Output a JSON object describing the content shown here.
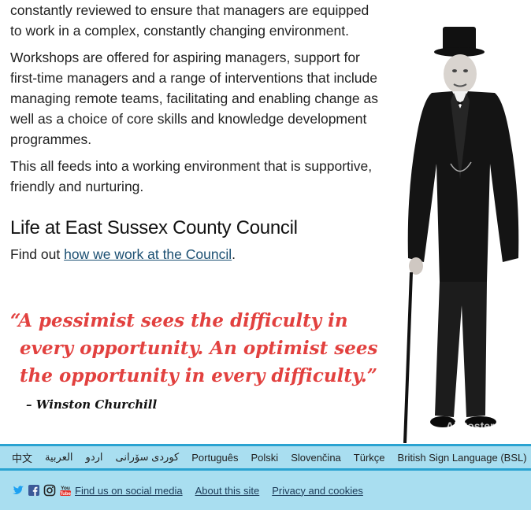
{
  "paragraphs": [
    "constantly reviewed to ensure that managers are equipped to work in a complex, constantly changing environment.",
    "Workshops are offered for aspiring managers, support for first-time managers and a range of interventions that include managing remote teams, facilitating and enabling change as well as a choice of core skills and knowledge development programmes.",
    "This all feeds into a working environment that is supportive, friendly and nurturing."
  ],
  "section": {
    "title": "Life at East Sussex County Council",
    "find_prefix": "Find out ",
    "find_link": "how we work at the Council",
    "find_suffix": "."
  },
  "quote": {
    "line1": "“A pessimist sees the difficulty in",
    "line2": "every opportunity. An optimist sees",
    "line3": "the opportunity in every difficulty.”",
    "author": "– Winston Churchill"
  },
  "photo": {
    "watermark": "AllPosters"
  },
  "languages": [
    "中文",
    "العربية",
    "اردو",
    "کوردی سۆرانی",
    "Português",
    "Polski",
    "Slovenčina",
    "Türkçe",
    "British Sign Language (BSL)"
  ],
  "footer": {
    "icons": [
      "twitter-icon",
      "facebook-icon",
      "instagram-icon",
      "youtube-icon"
    ],
    "youtube_text": "You Tube",
    "social_link": "Find us on social media",
    "about_link": "About this site",
    "privacy_link": "Privacy and cookies"
  },
  "colors": {
    "quote": "#e2413f",
    "bar": "#a9def0",
    "bar_border": "#2aa3d1",
    "link": "#1b4f72"
  }
}
